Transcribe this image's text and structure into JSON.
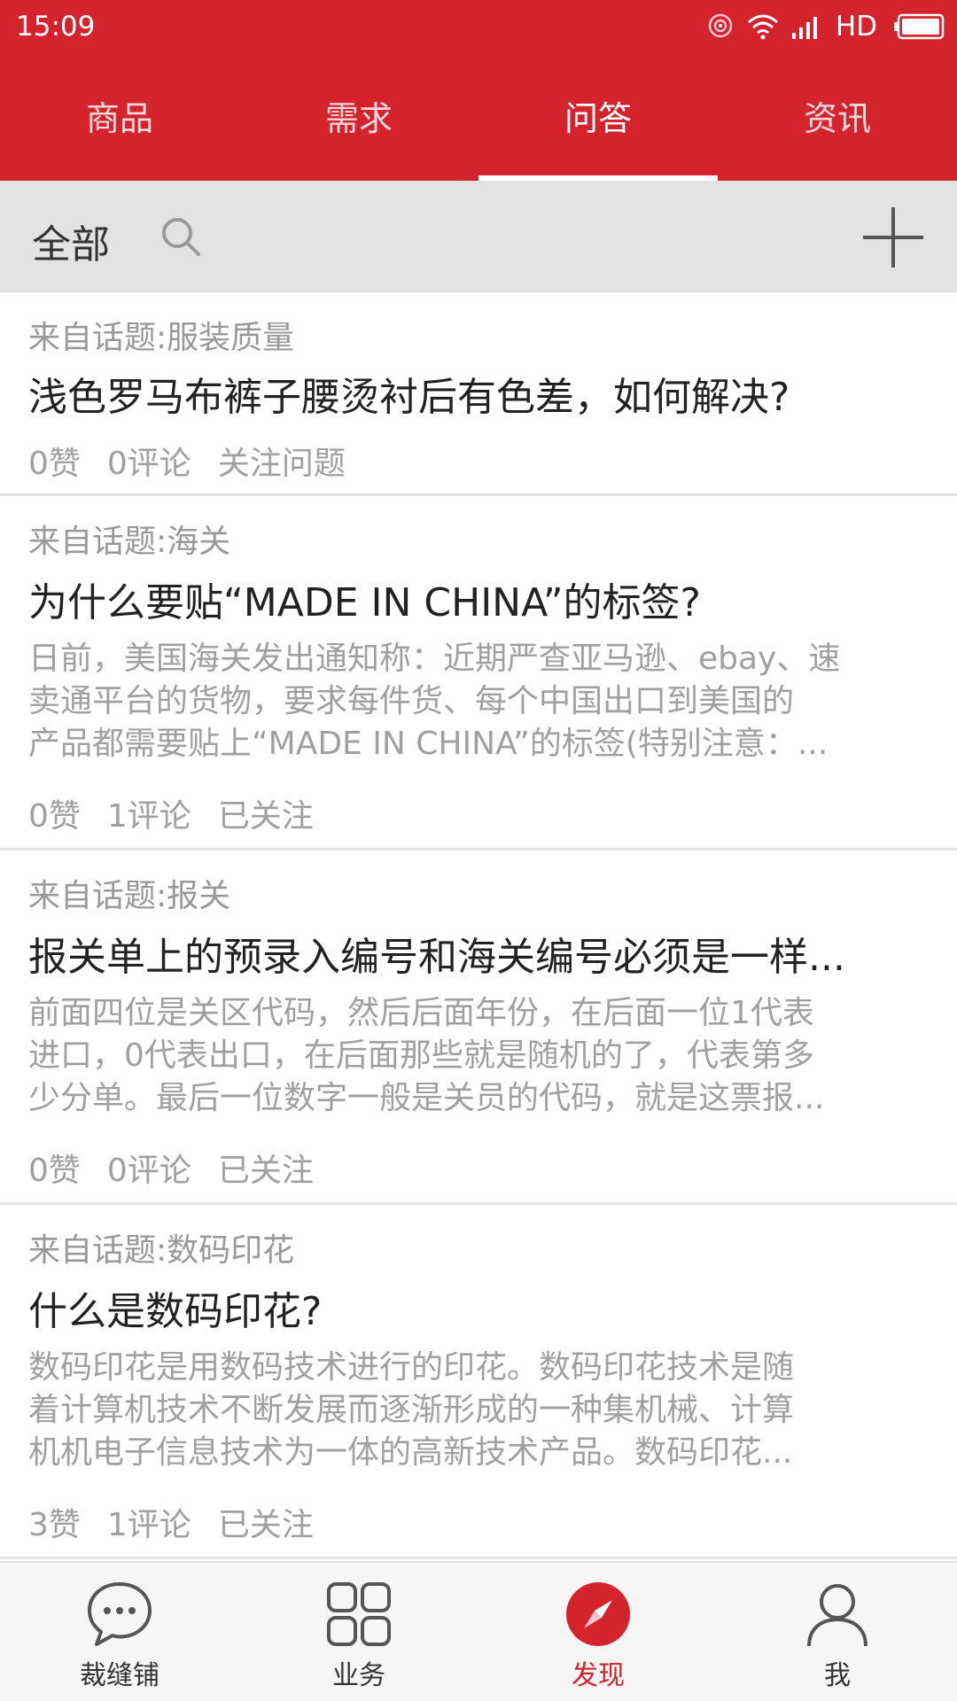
{
  "status_bar": {
    "time": "15:09",
    "network": "HD"
  },
  "tabs": [
    {
      "label": "商品",
      "active": false
    },
    {
      "label": "需求",
      "active": false
    },
    {
      "label": "问答",
      "active": true
    },
    {
      "label": "资讯",
      "active": false
    }
  ],
  "filter": {
    "label": "全部",
    "search_icon": "search-icon",
    "add_icon": "plus-icon"
  },
  "posts": [
    {
      "topic": "来自话题:服装质量",
      "title": "浅色罗马布裤子腰烫衬后有色差，如何解决?",
      "excerpt": [],
      "likes": "0赞",
      "comments": "0评论",
      "follow": "关注问题"
    },
    {
      "topic": "来自话题:海关",
      "title": "为什么要贴“MADE IN CHINA”的标签?",
      "excerpt": [
        "日前，美国海关发出通知称：近期严查亚马逊、ebay、速",
        "卖通平台的货物，要求每件货、每个中国出口到美国的",
        "产品都需要贴上“MADE IN CHINA”的标签(特别注意：..."
      ],
      "likes": "0赞",
      "comments": "1评论",
      "follow": "已关注"
    },
    {
      "topic": "来自话题:报关",
      "title": "报关单上的预录入编号和海关编号必须是一样...",
      "excerpt": [
        "前面四位是关区代码，然后后面年份，在后面一位1代表",
        "进口，0代表出口，在后面那些就是随机的了，代表第多",
        "少分单。最后一位数字一般是关员的代码，就是这票报..."
      ],
      "likes": "0赞",
      "comments": "0评论",
      "follow": "已关注"
    },
    {
      "topic": "来自话题:数码印花",
      "title": "什么是数码印花?",
      "excerpt": [
        "数码印花是用数码技术进行的印花。数码印花技术是随",
        "着计算机技术不断发展而逐渐形成的一种集机械、计算",
        "机机电子信息技术为一体的高新技术产品。数码印花..."
      ],
      "likes": "3赞",
      "comments": "1评论",
      "follow": "已关注"
    }
  ],
  "bottom_nav": [
    {
      "label": "裁缝铺",
      "icon": "chat-bubble-icon",
      "active": false
    },
    {
      "label": "业务",
      "icon": "grid-icon",
      "active": false
    },
    {
      "label": "发现",
      "icon": "compass-icon",
      "active": true
    },
    {
      "label": "我",
      "icon": "user-icon",
      "active": false
    }
  ],
  "colors": {
    "brand_red": "#d5232d",
    "filter_bg": "#e3e3e3",
    "muted_text": "#a0a0a0"
  }
}
